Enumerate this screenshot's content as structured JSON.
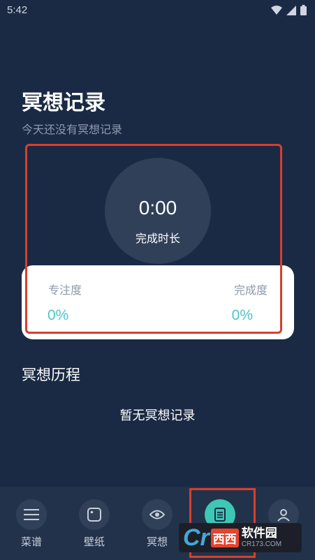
{
  "status_bar": {
    "time": "5:42"
  },
  "header": {
    "title": "冥想记录",
    "subtitle": "今天还没有冥想记录"
  },
  "summary": {
    "duration_value": "0:00",
    "duration_label": "完成时长"
  },
  "stats": {
    "focus_label": "专注度",
    "focus_value": "0%",
    "completion_label": "完成度",
    "completion_value": "0%"
  },
  "history": {
    "title": "冥想历程",
    "empty_text": "暂无冥想记录"
  },
  "tabbar": {
    "items": [
      {
        "label": "菜谱",
        "icon": "menu-icon"
      },
      {
        "label": "壁纸",
        "icon": "wallpaper-icon"
      },
      {
        "label": "冥想",
        "icon": "eye-icon"
      },
      {
        "label": "",
        "icon": "record-icon",
        "active": true
      },
      {
        "label": "",
        "icon": "user-icon"
      }
    ]
  },
  "watermark": {
    "letters": "Cr",
    "badge": "西西",
    "name": "软件园",
    "url": "CR173.COM"
  },
  "colors": {
    "background": "#1b2a44",
    "accent": "#3cc8b4",
    "highlight": "#d4402f"
  }
}
